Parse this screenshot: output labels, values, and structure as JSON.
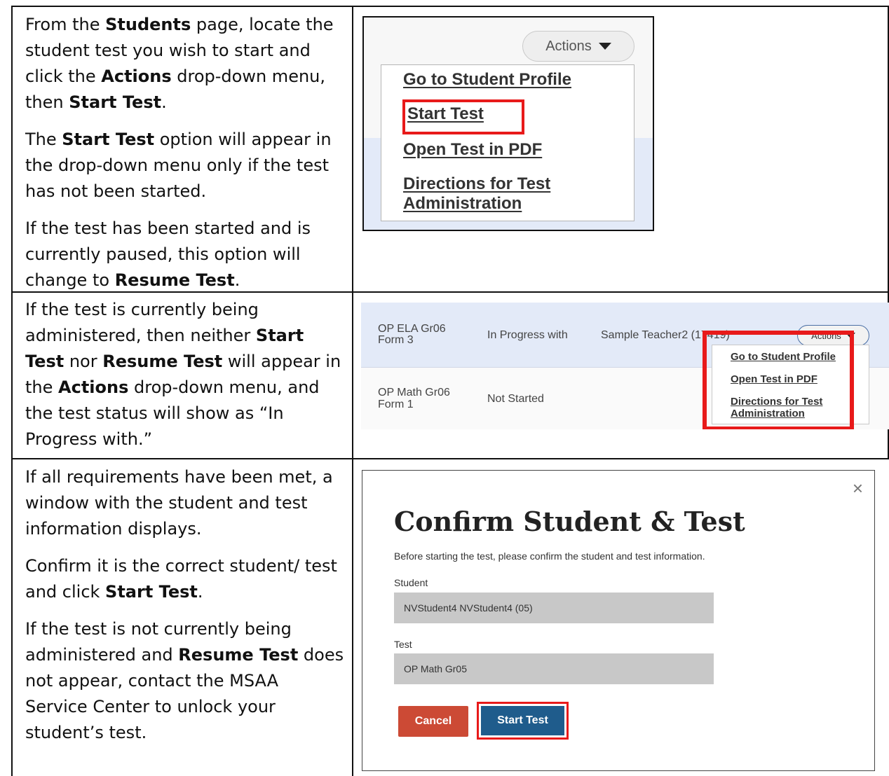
{
  "rows": [
    {
      "paragraphs": [
        {
          "parts": [
            {
              "t": "From the "
            },
            {
              "t": "Students",
              "b": true
            },
            {
              "t": " page, locate the student test you wish to start and click the "
            },
            {
              "t": "Actions",
              "b": true
            },
            {
              "t": " drop-down menu, then "
            },
            {
              "t": "Start Test",
              "b": true
            },
            {
              "t": "."
            }
          ]
        },
        {
          "parts": [
            {
              "t": "The "
            },
            {
              "t": "Start Test",
              "b": true
            },
            {
              "t": " option will appear in the drop-down menu only if the test has not been started."
            }
          ]
        },
        {
          "parts": [
            {
              "t": "If the test has been started and is currently paused, this option will change to "
            },
            {
              "t": "Resume Test",
              "b": true
            },
            {
              "t": "."
            }
          ]
        }
      ]
    },
    {
      "paragraphs": [
        {
          "parts": [
            {
              "t": "If the test is currently being administered, then neither "
            },
            {
              "t": "Start Test",
              "b": true
            },
            {
              "t": " nor "
            },
            {
              "t": "Resume Test",
              "b": true
            },
            {
              "t": " will appear in the "
            },
            {
              "t": "Actions",
              "b": true
            },
            {
              "t": " drop-down menu, and the test status will show as “In Progress with.”"
            }
          ]
        }
      ]
    },
    {
      "paragraphs": [
        {
          "parts": [
            {
              "t": "If all requirements have been met, a window with the student and test information displays."
            }
          ]
        },
        {
          "parts": [
            {
              "t": "Confirm it is the correct student/ test and click "
            },
            {
              "t": "Start Test",
              "b": true
            },
            {
              "t": "."
            }
          ]
        },
        {
          "parts": [
            {
              "t": "If the test is not currently being administered and "
            },
            {
              "t": "Resume Test",
              "b": true
            },
            {
              "t": " does not appear, contact the MSAA Service Center to unlock your student’s test."
            }
          ]
        }
      ]
    }
  ],
  "shot1": {
    "actions_label": "Actions",
    "menu_items": [
      "Go to Student Profile",
      "Start Test",
      "Open Test in PDF",
      "Directions for Test Administration"
    ],
    "highlight_color": "#e81a1a"
  },
  "shot2": {
    "rows": [
      {
        "test_line1": "OP ELA Gr06",
        "test_line2": "Form 3",
        "status": "In Progress with",
        "teacher": "Sample Teacher2 (17419)"
      },
      {
        "test_line1": "OP Math Gr06",
        "test_line2": "Form 1",
        "status": "Not Started"
      }
    ],
    "actions_label": "Actions",
    "menu_items": [
      "Go to Student Profile",
      "Open Test in PDF",
      "Directions for Test",
      "Administration"
    ]
  },
  "shot3": {
    "close_glyph": "×",
    "title": "Confirm Student & Test",
    "subtitle": "Before starting the test, please confirm the student and test information.",
    "student_label": "Student",
    "student_value": "NVStudent4 NVStudent4 (05)",
    "test_label": "Test",
    "test_value": "OP Math Gr05",
    "cancel_label": "Cancel",
    "start_label": "Start Test",
    "cancel_color": "#cc4a35",
    "start_color": "#1f5c8c"
  }
}
